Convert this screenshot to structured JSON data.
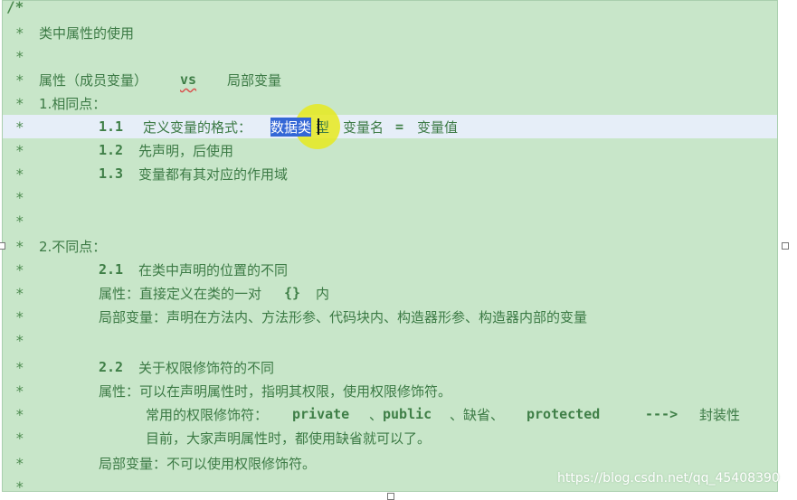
{
  "lines": {
    "l1": {
      "star": "*",
      "text": "类中属性的使用"
    },
    "l2": {
      "star": "*"
    },
    "l3": {
      "star": "*",
      "a": "属性（成员变量）",
      "vs": "vs",
      "b": "局部变量"
    },
    "l4": {
      "star": "*",
      "text": "1.相同点："
    },
    "l5": {
      "star": "*",
      "num": "1.1",
      "pre": "定义变量的格式：",
      "sel": "数据类",
      "post_sel": "型",
      "rest": "变量名",
      "eq": "=",
      "val": "变量值"
    },
    "l6": {
      "star": "*",
      "num": "1.2",
      "text": "先声明，后使用"
    },
    "l7": {
      "star": "*",
      "num": "1.3",
      "text": "变量都有其对应的作用域"
    },
    "l8": {
      "star": "*"
    },
    "l9": {
      "star": "*"
    },
    "l10": {
      "star": "*",
      "text": "2.不同点："
    },
    "l11": {
      "star": "*",
      "num": "2.1",
      "text": "在类中声明的位置的不同"
    },
    "l12": {
      "star": "*",
      "a": "属性：直接定义在类的一对",
      "braces": "{}",
      "b": "内"
    },
    "l13": {
      "star": "*",
      "text": "局部变量：声明在方法内、方法形参、代码块内、构造器形参、构造器内部的变量"
    },
    "l14": {
      "star": "*"
    },
    "l15": {
      "star": "*",
      "num": "2.2",
      "text": "关于权限修饰符的不同"
    },
    "l16": {
      "star": "*",
      "text": "属性：可以在声明属性时，指明其权限，使用权限修饰符。"
    },
    "l17": {
      "star": "*",
      "a": "常用的权限修饰符：",
      "m1": "private",
      "s1": "、",
      "m2": "public",
      "s2": "、缺省、",
      "m3": "protected",
      "arrow": "--->",
      "b": "封装性"
    },
    "l18": {
      "star": "*",
      "text": "目前，大家声明属性时，都使用缺省就可以了。"
    },
    "l19": {
      "star": "*",
      "text": "局部变量：不可以使用权限修饰符。"
    },
    "l20": {
      "star": "*"
    }
  },
  "top_slash": "/*",
  "watermark": "https://blog.csdn.net/qq_45408390",
  "colors": {
    "background": "#c8e6c9",
    "current_line": "#e6eef8",
    "selection": "#3467d6",
    "cursor_highlight": "#e6e91e"
  }
}
